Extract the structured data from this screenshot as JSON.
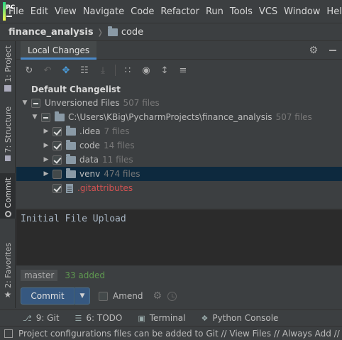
{
  "menu": {
    "logo": "PC",
    "items": [
      "File",
      "Edit",
      "View",
      "Navigate",
      "Code",
      "Refactor",
      "Run",
      "Tools",
      "VCS",
      "Window",
      "Help"
    ]
  },
  "breadcrumb": {
    "project": "finance_analysis",
    "folder": "code"
  },
  "sidebar": {
    "project": "1: Project",
    "structure": "7: Structure",
    "commit": "Commit",
    "favorites": "2: Favorites"
  },
  "panel": {
    "tab": "Local Changes"
  },
  "tree": {
    "changelist": "Default Changelist",
    "unversioned": {
      "label": "Unversioned Files",
      "count": "507 files"
    },
    "root": {
      "path": "C:\\Users\\KBig\\PycharmProjects\\finance_analysis",
      "count": "507 files"
    },
    "children": [
      {
        "name": ".idea",
        "count": "7 files",
        "checked": true
      },
      {
        "name": "code",
        "count": "14 files",
        "checked": true
      },
      {
        "name": "data",
        "count": "11 files",
        "checked": true
      },
      {
        "name": "venv",
        "count": "474 files",
        "checked": false
      }
    ],
    "file": {
      "name": ".gitattributes"
    }
  },
  "commit": {
    "message": "Initial File Upload",
    "branch": "master",
    "added": "33 added",
    "button": "Commit",
    "amend": "Amend"
  },
  "bottom_tabs": {
    "git": "9: Git",
    "todo": "6: TODO",
    "terminal": "Terminal",
    "python_console": "Python Console"
  },
  "status": "Project configurations files can be added to Git // View Files // Always Add // Don't Ask"
}
